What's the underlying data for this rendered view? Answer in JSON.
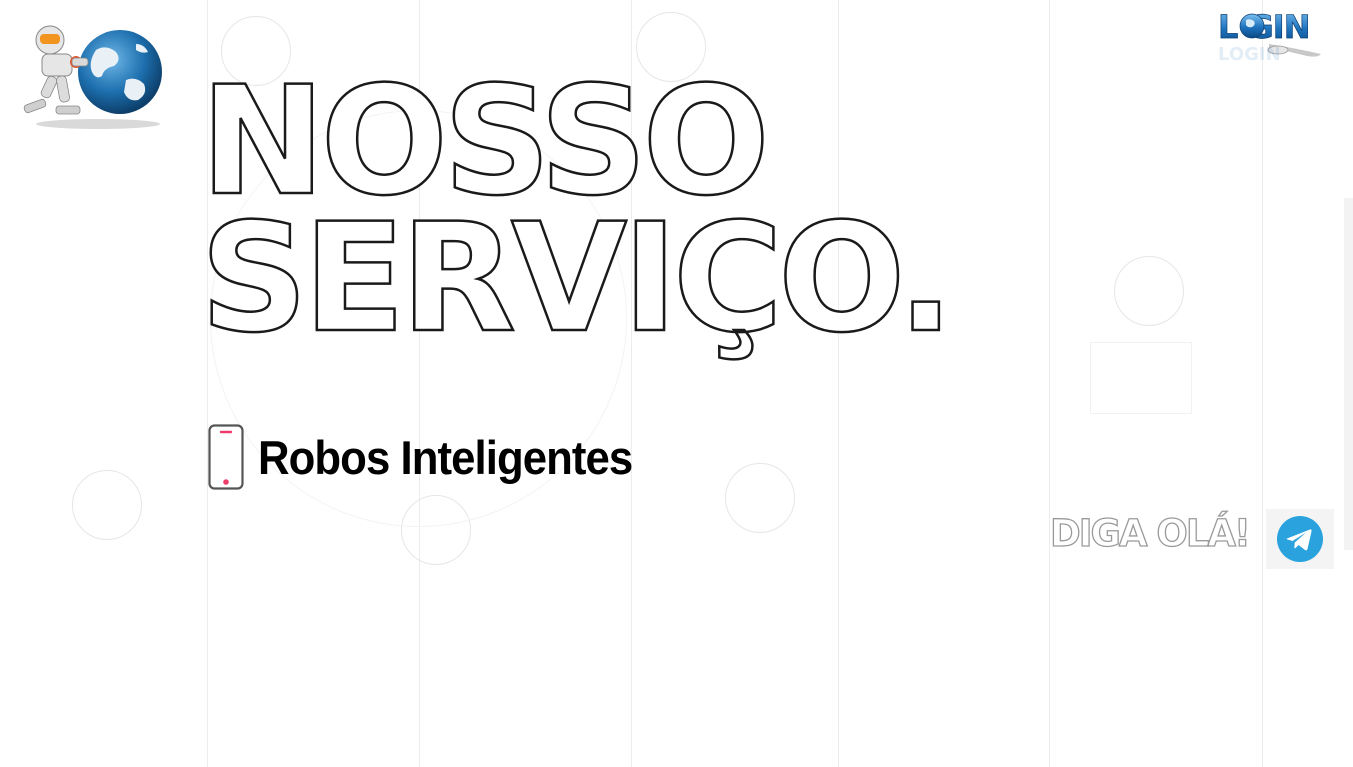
{
  "heading": {
    "line1": "NOSSO",
    "line2": "SERVIÇO."
  },
  "service": {
    "icon": "smartphone-icon",
    "label": "Robos Inteligentes"
  },
  "login": {
    "label": "LOGIN",
    "icon": "globe-icon"
  },
  "logo": {
    "icon": "robot-pushing-globe-logo"
  },
  "contact": {
    "label": "DIGA OLÁ!",
    "icon": "telegram-icon"
  },
  "colors": {
    "accent": "#ee3d6a",
    "telegram": "#2aa2dd",
    "login_blue": "#1e73be",
    "outline": "#1a1a1a"
  }
}
